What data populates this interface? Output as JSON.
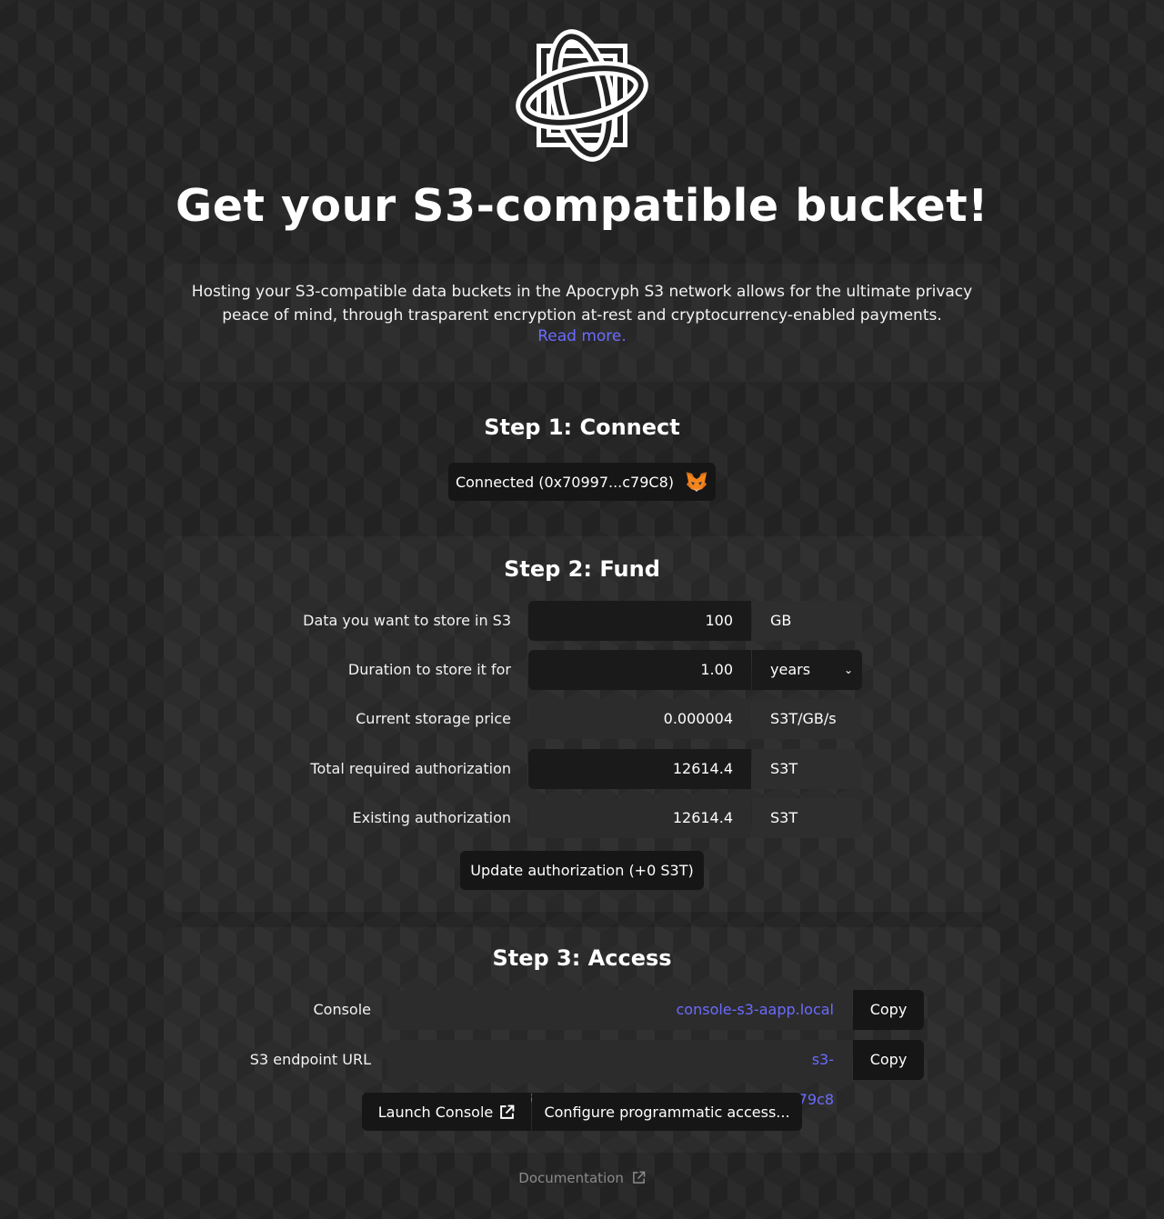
{
  "header": {
    "title": "Get your S3-compatible bucket!",
    "intro": "Hosting your S3-compatible data buckets in the Apocryph S3 network allows for the ultimate privacy peace of mind, through trasparent encryption at-rest and cryptocurrency-enabled payments.",
    "read_more": "Read more."
  },
  "step1": {
    "title": "Step 1: Connect",
    "connected_label": "Connected (0x70997...c79C8)",
    "wallet_icon": "metamask-fox-icon"
  },
  "step2": {
    "title": "Step 2: Fund",
    "rows": [
      {
        "label": "Data you want to store in S3",
        "value": "100",
        "unit": "GB"
      },
      {
        "label": "Duration to store it for",
        "value": "1.00",
        "unit": "years"
      },
      {
        "label": "Current storage price",
        "value": "0.000004",
        "unit": "S3T/GB/s"
      },
      {
        "label": "Total required authorization",
        "value": "12614.4",
        "unit": "S3T"
      },
      {
        "label": "Existing authorization",
        "value": "12614.4",
        "unit": "S3T"
      }
    ],
    "update_button": "Update authorization (+0 S3T)"
  },
  "step3": {
    "title": "Step 3: Access",
    "console_label": "Console",
    "console_url": "console-s3-aapp.local",
    "endpoint_label": "S3 endpoint URL",
    "endpoint_url": "s3-aapp.local/70997970c51812dc3a010c7d01b50e0d17dc79c8",
    "copy_label": "Copy",
    "launch_console": "Launch Console",
    "configure": "Configure programmatic access..."
  },
  "footer": {
    "documentation": "Documentation"
  },
  "colors": {
    "accent_link": "#6b6bff",
    "background": "#222222",
    "button_bg": "#161616"
  }
}
